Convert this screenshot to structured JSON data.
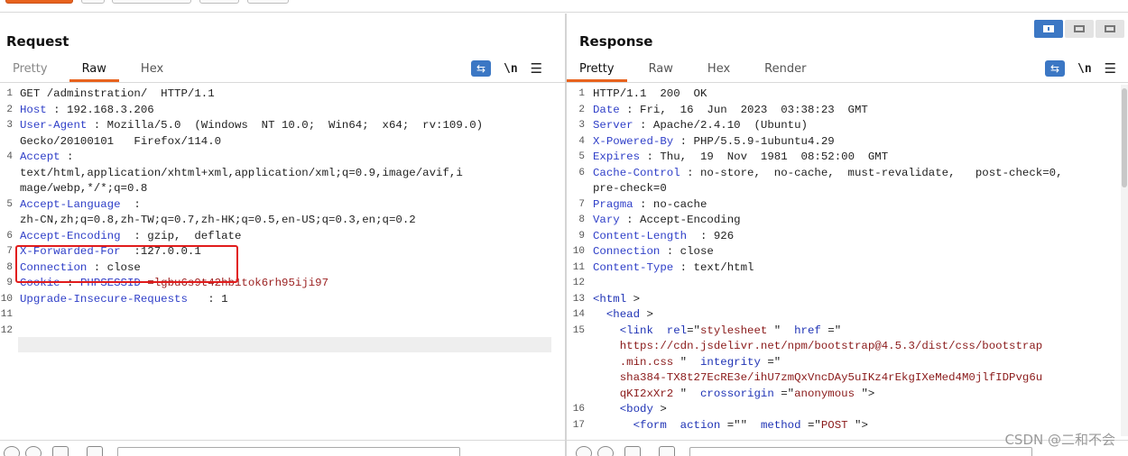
{
  "request": {
    "title": "Request",
    "tabs": [
      "Pretty",
      "Raw",
      "Hex"
    ],
    "active_tab": "Raw",
    "lines": [
      {
        "n": "1",
        "k": "",
        "v": "GET /adminstration/  HTTP/1.1"
      },
      {
        "n": "2",
        "k": "Host",
        "v": " : 192.168.3.206"
      },
      {
        "n": "3",
        "k": "User-Agent",
        "v": " : Mozilla/5.0  (Windows  NT 10.0;  Win64;  x64;  rv:109.0)"
      },
      {
        "n": "",
        "k": "",
        "v": "Gecko/20100101   Firefox/114.0"
      },
      {
        "n": "4",
        "k": "Accept",
        "v": " :"
      },
      {
        "n": "",
        "k": "",
        "v": "text/html,application/xhtml+xml,application/xml;q=0.9,image/avif,i"
      },
      {
        "n": "",
        "k": "",
        "v": "mage/webp,*/*;q=0.8"
      },
      {
        "n": "5",
        "k": "Accept-Language",
        "v": "  :"
      },
      {
        "n": "",
        "k": "",
        "v": "zh-CN,zh;q=0.8,zh-TW;q=0.7,zh-HK;q=0.5,en-US;q=0.3,en;q=0.2"
      },
      {
        "n": "6",
        "k": "Accept-Encoding",
        "v": "  : gzip,  deflate"
      },
      {
        "n": "7",
        "k": "X-Forwarded-For",
        "v": "  :127.0.0.1"
      },
      {
        "n": "8",
        "k": "Connection",
        "v": " : close"
      },
      {
        "n": "9",
        "k": "Cookie",
        "v": " : ",
        "k2": "PHPSESSID",
        "v2": " =lgbu6s9t42hb1tok6rh95iji97"
      },
      {
        "n": "10",
        "k": "Upgrade-Insecure-Requests",
        "v": "   : 1"
      },
      {
        "n": "11",
        "k": "",
        "v": ""
      },
      {
        "n": "12",
        "k": "",
        "v": ""
      }
    ]
  },
  "response": {
    "title": "Response",
    "tabs": [
      "Pretty",
      "Raw",
      "Hex",
      "Render"
    ],
    "active_tab": "Pretty",
    "lines": [
      {
        "n": "1",
        "html": "<span class='hv'>HTTP/1.1  200  OK</span>"
      },
      {
        "n": "2",
        "html": "<span class='hk'>Date</span><span class='hv'> : Fri,  16  Jun  2023  03:38:23  GMT</span>"
      },
      {
        "n": "3",
        "html": "<span class='hk'>Server</span><span class='hv'> : Apache/2.4.10  (Ubuntu)</span>"
      },
      {
        "n": "4",
        "html": "<span class='hk'>X-Powered-By</span><span class='hv'> : PHP/5.5.9-1ubuntu4.29</span>"
      },
      {
        "n": "5",
        "html": "<span class='hk'>Expires</span><span class='hv'> : Thu,  19  Nov  1981  08:52:00  GMT</span>"
      },
      {
        "n": "6",
        "html": "<span class='hk'>Cache-Control</span><span class='hv'> : no-store,  no-cache,  must-revalidate,   post-check=0,</span>"
      },
      {
        "n": "",
        "html": "<span class='hv'>pre-check=0</span>"
      },
      {
        "n": "7",
        "html": "<span class='hk'>Pragma</span><span class='hv'> : no-cache</span>"
      },
      {
        "n": "8",
        "html": "<span class='hk'>Vary</span><span class='hv'> : Accept-Encoding</span>"
      },
      {
        "n": "9",
        "html": "<span class='hk'>Content-Length</span><span class='hv'>  : 926</span>"
      },
      {
        "n": "10",
        "html": "<span class='hk'>Connection</span><span class='hv'> : close</span>"
      },
      {
        "n": "11",
        "html": "<span class='hk'>Content-Type</span><span class='hv'> : text/html</span>"
      },
      {
        "n": "12",
        "html": ""
      },
      {
        "n": "13",
        "html": "<span class='tg'>&lt;html</span><span class='hv'> &gt;</span>"
      },
      {
        "n": "14",
        "html": "<span class='hv'>  </span><span class='tg'>&lt;head</span><span class='hv'> &gt;</span>"
      },
      {
        "n": "15",
        "html": "<span class='hv'>    </span><span class='tg'>&lt;link</span> <span class='at'> rel</span><span class='hv'>=\"</span><span class='av'>stylesheet</span><span class='hv'> \"  </span><span class='at'>href</span><span class='hv'> =\"</span>"
      },
      {
        "n": "",
        "html": "<span class='av'>    https://cdn.jsdelivr.net/npm/bootstrap@4.5.3/dist/css/bootstrap</span>"
      },
      {
        "n": "",
        "html": "<span class='av'>    .min.css</span><span class='hv'> \"  </span><span class='at'>integrity</span><span class='hv'> =\"</span>"
      },
      {
        "n": "",
        "html": "<span class='av'>    sha384-TX8t27EcRE3e/ihU7zmQxVncDAy5uIKz4rEkgIXeMed4M0jlfIDPvg6u</span>"
      },
      {
        "n": "",
        "html": "<span class='av'>    qKI2xXr2</span><span class='hv'> \"  </span><span class='at'>crossorigin</span><span class='hv'> =\"</span><span class='av'>anonymous</span><span class='hv'> \"&gt;</span>"
      },
      {
        "n": "16",
        "html": "<span class='hv'>    </span><span class='tg'>&lt;body</span><span class='hv'> &gt;</span>"
      },
      {
        "n": "17",
        "html": "<span class='hv'>      </span><span class='tg'>&lt;form</span> <span class='at'> action</span><span class='hv'> =\"\"  </span><span class='at'>method</span><span class='hv'> =\"</span><span class='av'>POST</span><span class='hv'> \"&gt;</span>"
      }
    ]
  },
  "watermark": "CSDN @二和不会",
  "icons": {
    "wrap": "word-wrap-icon",
    "newline": "\\n",
    "menu": "menu-icon"
  }
}
